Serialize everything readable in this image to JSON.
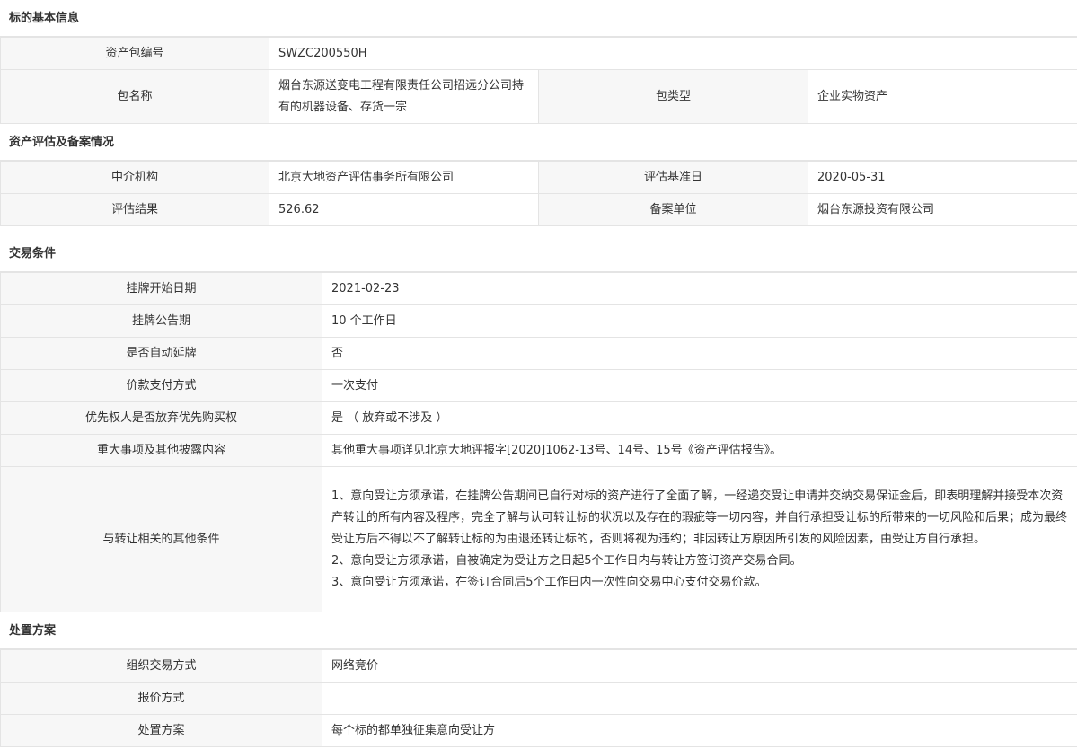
{
  "sections": {
    "basic": {
      "title": "标的基本信息",
      "asset_no_label": "资产包编号",
      "asset_no": "SWZC200550H",
      "pkg_name_label": "包名称",
      "pkg_name": "烟台东源送变电工程有限责任公司招远分公司持有的机器设备、存货一宗",
      "pkg_type_label": "包类型",
      "pkg_type": "企业实物资产"
    },
    "eval": {
      "title": "资产评估及备案情况",
      "agency_label": "中介机构",
      "agency": "北京大地资产评估事务所有限公司",
      "base_date_label": "评估基准日",
      "base_date": "2020-05-31",
      "result_label": "评估结果",
      "result": "526.62",
      "record_unit_label": "备案单位",
      "record_unit": "烟台东源投资有限公司"
    },
    "trade": {
      "title": "交易条件",
      "start_date_label": "挂牌开始日期",
      "start_date": "2021-02-23",
      "period_label": "挂牌公告期",
      "period": "10 个工作日",
      "auto_extend_label": "是否自动延牌",
      "auto_extend": "否",
      "payment_label": "价款支付方式",
      "payment": "一次支付",
      "preempt_label": "优先权人是否放弃优先购买权",
      "preempt": "是 （ 放弃或不涉及 ）",
      "disclosure_label": "重大事项及其他披露内容",
      "disclosure": "其他重大事项详见北京大地评报字[2020]1062-13号、14号、15号《资产评估报告》。",
      "other_label": "与转让相关的其他条件",
      "other_lines": [
        "1、意向受让方须承诺，在挂牌公告期间已自行对标的资产进行了全面了解，一经递交受让申请并交纳交易保证金后，即表明理解并接受本次资产转让的所有内容及程序，完全了解与认可转让标的状况以及存在的瑕疵等一切内容，并自行承担受让标的所带来的一切风险和后果；成为最终受让方后不得以不了解转让标的为由退还转让标的，否则将视为违约；非因转让方原因所引发的风险因素，由受让方自行承担。",
        "2、意向受让方须承诺，自被确定为受让方之日起5个工作日内与转让方签订资产交易合同。",
        "3、意向受让方须承诺，在签订合同后5个工作日内一次性向交易中心支付交易价款。"
      ]
    },
    "disposal": {
      "title": "处置方案",
      "method_label": "组织交易方式",
      "method": "网络竞价",
      "quote_label": "报价方式",
      "quote": "",
      "plan_label": "处置方案",
      "plan": "每个标的都单独征集意向受让方"
    }
  }
}
